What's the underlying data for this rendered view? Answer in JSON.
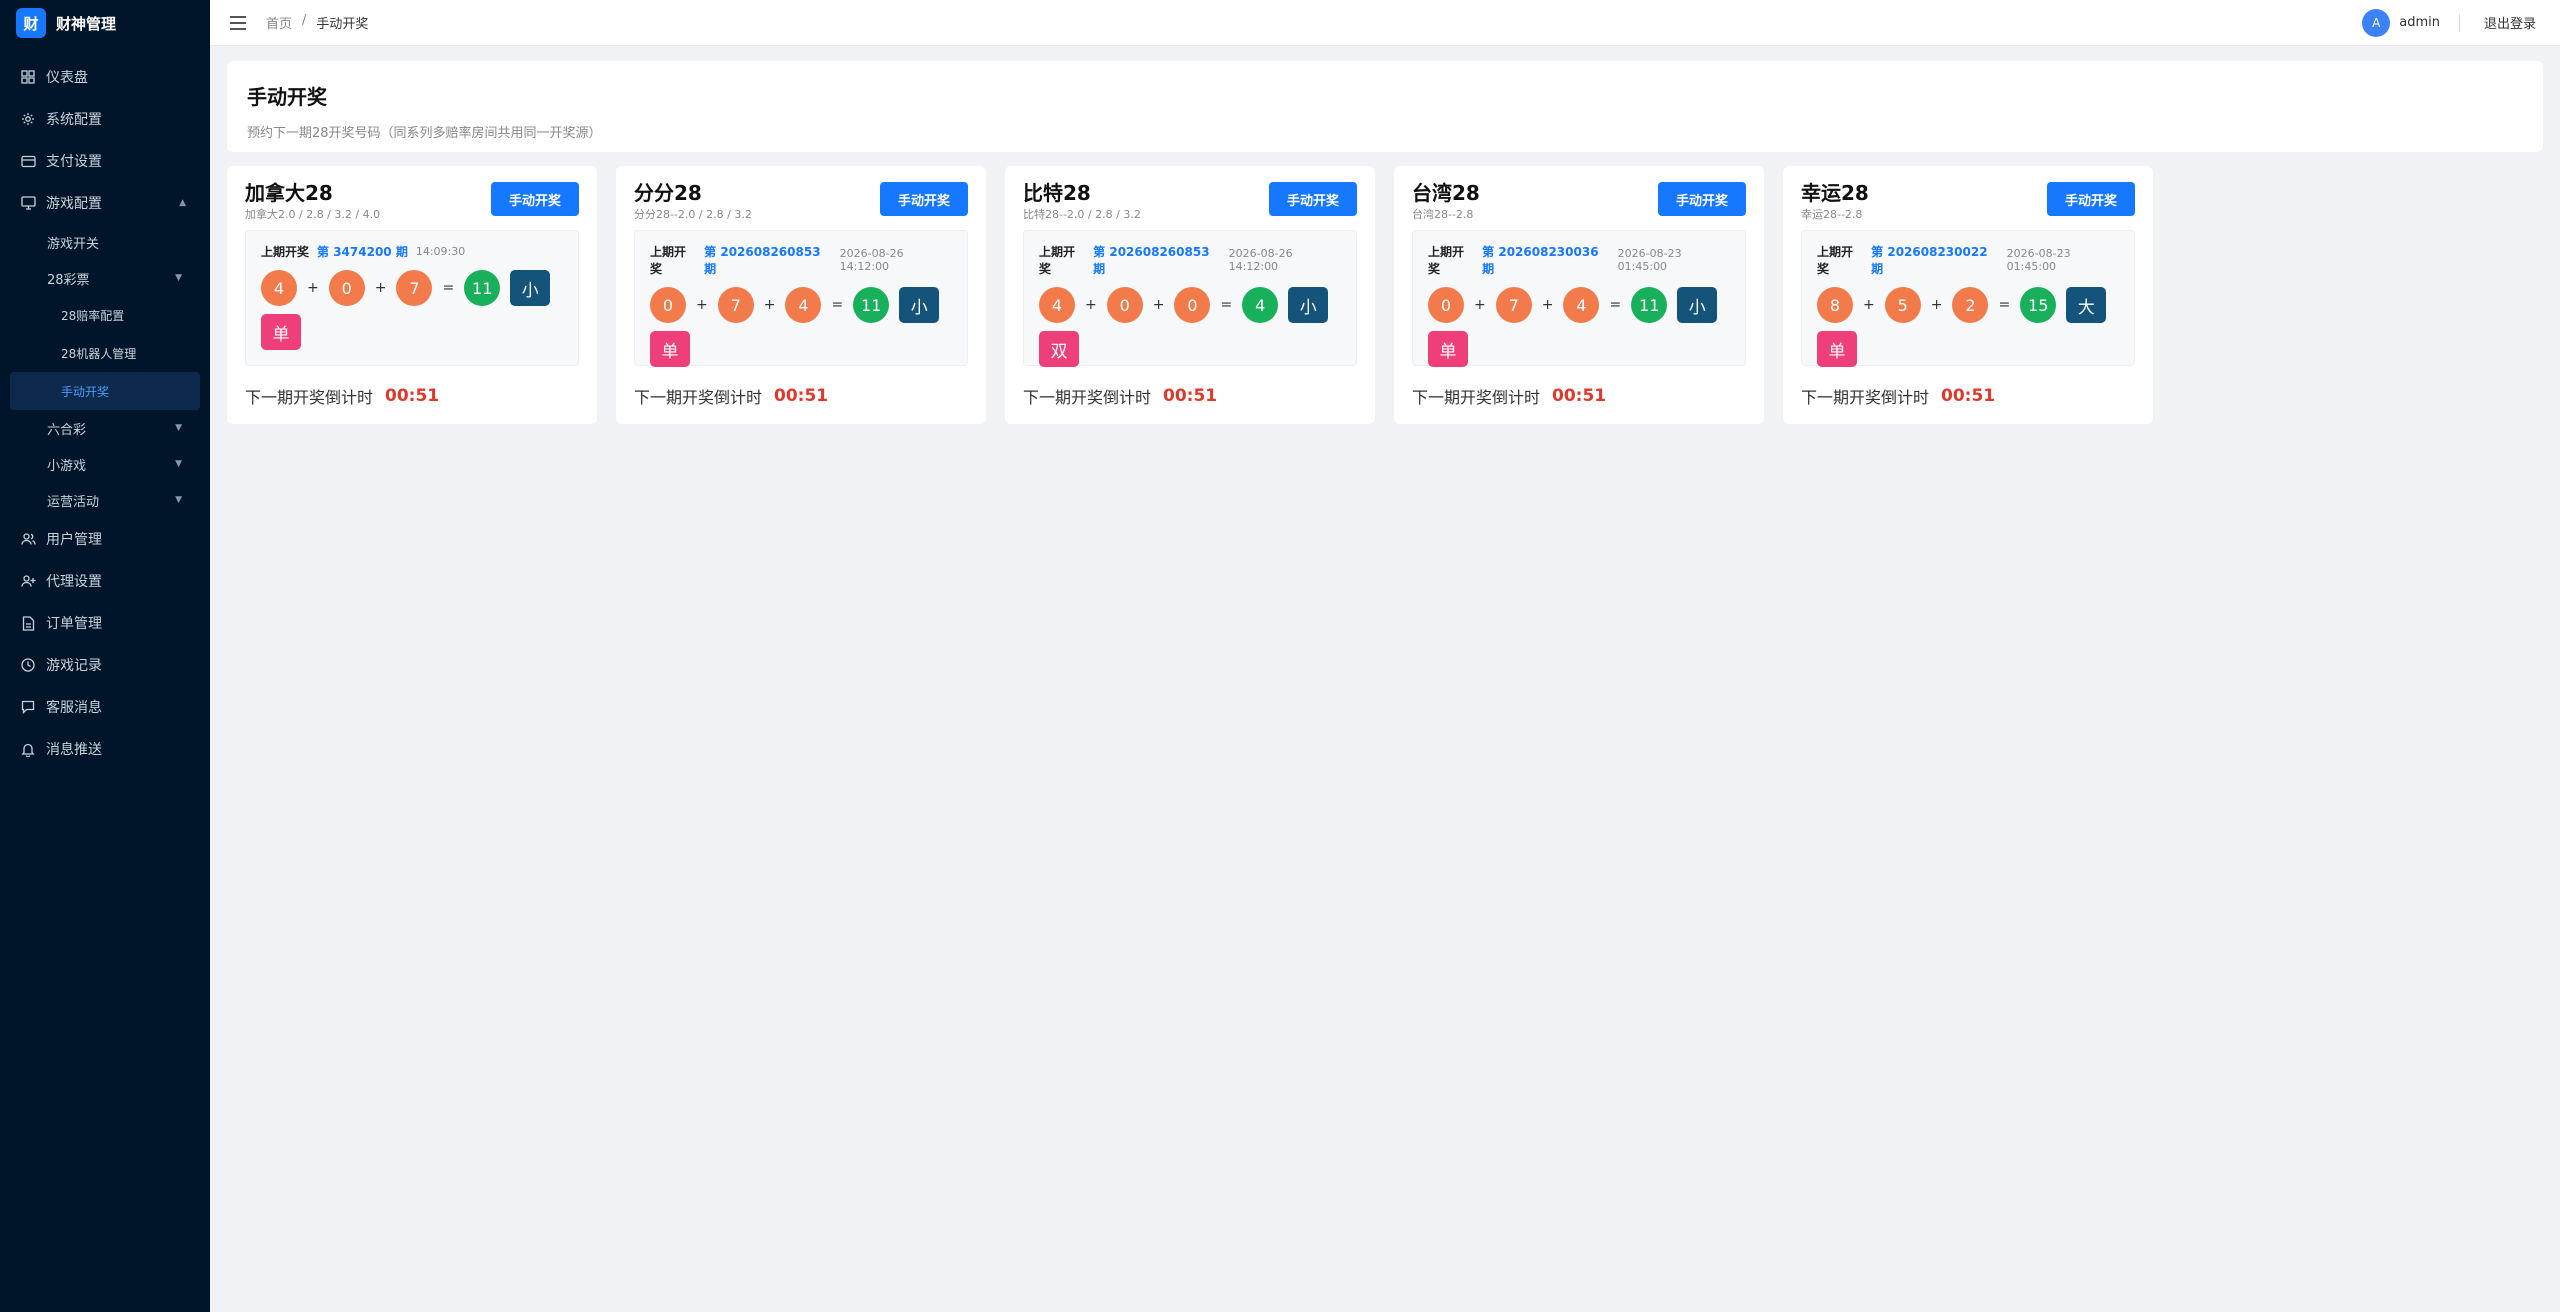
{
  "brand": {
    "logo": "财",
    "title": "财神管理"
  },
  "sidebar": {
    "items": [
      {
        "label": "仪表盘",
        "icon": "dashboard-icon"
      },
      {
        "label": "系统配置",
        "icon": "gear-icon"
      },
      {
        "label": "支付设置",
        "icon": "card-icon"
      },
      {
        "label": "游戏配置",
        "icon": "monitor-icon"
      },
      {
        "label": "游戏开关"
      },
      {
        "label": "28彩票"
      },
      {
        "label": "28赔率配置"
      },
      {
        "label": "28机器人管理"
      },
      {
        "label": "手动开奖"
      },
      {
        "label": "六合彩"
      },
      {
        "label": "小游戏"
      },
      {
        "label": "运营活动"
      },
      {
        "label": "用户管理",
        "icon": "users-icon"
      },
      {
        "label": "代理设置",
        "icon": "user-plus-icon"
      },
      {
        "label": "订单管理",
        "icon": "file-icon"
      },
      {
        "label": "游戏记录",
        "icon": "clock-icon"
      },
      {
        "label": "客服消息",
        "icon": "chat-icon"
      },
      {
        "label": "消息推送",
        "icon": "bell-icon"
      }
    ]
  },
  "header": {
    "breadcrumb": [
      "首页",
      "/",
      "手动开奖"
    ],
    "avatar": "A",
    "username": "admin",
    "logout": "退出登录"
  },
  "page": {
    "title": "手动开奖",
    "desc": "预约下一期28开奖号码（同系列多赔率房间共用同一开奖源）"
  },
  "cards": [
    {
      "name": "加拿大28",
      "odds": "加拿大2.0 / 2.8 / 3.2 / 4.0",
      "button": "手动开奖",
      "last_label": "上期开奖",
      "period": "第 3474200 期",
      "time": "14:09:30",
      "balls": [
        "4",
        "0",
        "7"
      ],
      "plus": "+",
      "eq": "=",
      "sum": "11",
      "size": "小",
      "parity": "单",
      "countdown_label": "下一期开奖倒计时",
      "countdown": "00:51"
    },
    {
      "name": "分分28",
      "odds": "分分28--2.0 / 2.8 / 3.2",
      "button": "手动开奖",
      "last_label": "上期开奖",
      "period": "第 202608260853 期",
      "time": "2026-08-26 14:12:00",
      "balls": [
        "0",
        "7",
        "4"
      ],
      "plus": "+",
      "eq": "=",
      "sum": "11",
      "size": "小",
      "parity": "单",
      "countdown_label": "下一期开奖倒计时",
      "countdown": "00:51"
    },
    {
      "name": "比特28",
      "odds": "比特28--2.0 / 2.8 / 3.2",
      "button": "手动开奖",
      "last_label": "上期开奖",
      "period": "第 202608260853 期",
      "time": "2026-08-26 14:12:00",
      "balls": [
        "4",
        "0",
        "0"
      ],
      "plus": "+",
      "eq": "=",
      "sum": "4",
      "size": "小",
      "parity": "双",
      "countdown_label": "下一期开奖倒计时",
      "countdown": "00:51"
    },
    {
      "name": "台湾28",
      "odds": "台湾28--2.8",
      "button": "手动开奖",
      "last_label": "上期开奖",
      "period": "第 202608230036 期",
      "time": "2026-08-23 01:45:00",
      "balls": [
        "0",
        "7",
        "4"
      ],
      "plus": "+",
      "eq": "=",
      "sum": "11",
      "size": "小",
      "parity": "单",
      "countdown_label": "下一期开奖倒计时",
      "countdown": "00:51"
    },
    {
      "name": "幸运28",
      "odds": "幸运28--2.8",
      "button": "手动开奖",
      "last_label": "上期开奖",
      "period": "第 202608230022 期",
      "time": "2026-08-23 01:45:00",
      "balls": [
        "8",
        "5",
        "2"
      ],
      "plus": "+",
      "eq": "=",
      "sum": "15",
      "size": "大",
      "parity": "单",
      "countdown_label": "下一期开奖倒计时",
      "countdown": "00:51"
    }
  ]
}
